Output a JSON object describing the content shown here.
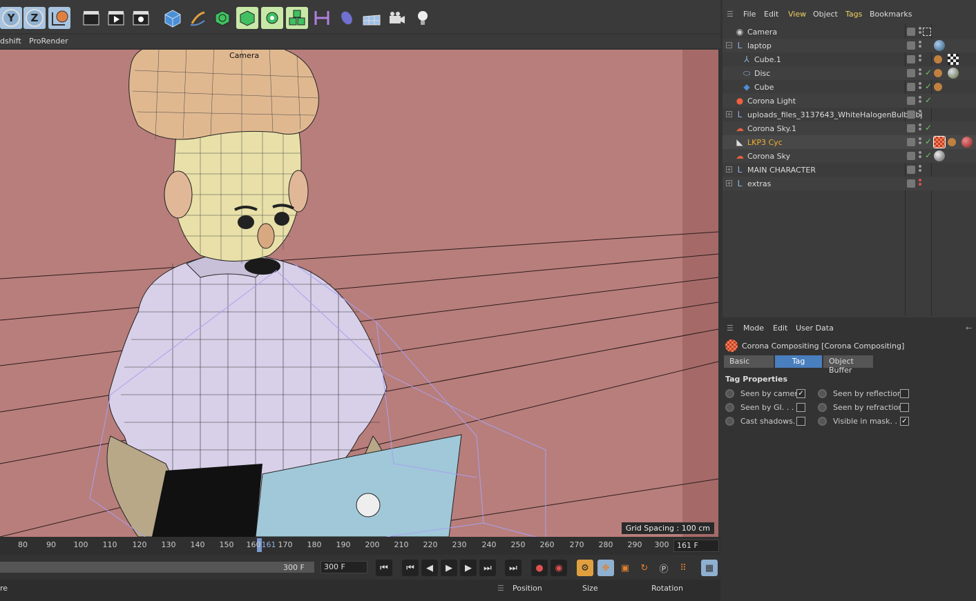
{
  "viewport_menu": {
    "items": [
      "dshift",
      "ProRender"
    ]
  },
  "viewport": {
    "camera_label": "Camera",
    "grid_spacing": "Grid Spacing : 100 cm"
  },
  "toolbar": {
    "axis_buttons": [
      "Y",
      "Z"
    ]
  },
  "timeline": {
    "ticks": [
      "80",
      "90",
      "100",
      "110",
      "120",
      "130",
      "140",
      "150",
      "160",
      "161",
      "170",
      "180",
      "190",
      "200",
      "210",
      "220",
      "230",
      "240",
      "250",
      "260",
      "270",
      "280",
      "290",
      "300"
    ],
    "current_frame": "161 F",
    "end_frame": "300 F",
    "max_frame": "300 F"
  },
  "bottom_bar": {
    "left": "re",
    "position": "Position",
    "size": "Size",
    "rotation": "Rotation"
  },
  "object_manager": {
    "menu": [
      "File",
      "Edit",
      "View",
      "Object",
      "Tags",
      "Bookmarks"
    ],
    "objects": [
      {
        "name": "Camera",
        "icon": "camera-icon"
      },
      {
        "name": "laptop",
        "icon": "null-icon"
      },
      {
        "name": "Cube.1",
        "icon": "bend-icon"
      },
      {
        "name": "Disc",
        "icon": "disc-icon"
      },
      {
        "name": "Cube",
        "icon": "cube-icon"
      },
      {
        "name": "Corona Light",
        "icon": "light-icon"
      },
      {
        "name": "uploads_files_3137643_WhiteHalogenBulb.obj",
        "icon": "null-icon"
      },
      {
        "name": "Corona Sky.1",
        "icon": "sky-icon"
      },
      {
        "name": "LKP3 Cyc",
        "icon": "cyc-icon"
      },
      {
        "name": "Corona Sky",
        "icon": "sky-icon"
      },
      {
        "name": "MAIN CHARACTER",
        "icon": "null-icon"
      },
      {
        "name": "extras",
        "icon": "null-icon"
      }
    ]
  },
  "attribute_manager": {
    "menu": [
      "Mode",
      "Edit",
      "User Data"
    ],
    "title": "Corona Compositing [Corona Compositing]",
    "tabs": [
      "Basic",
      "Tag",
      "Object Buffer"
    ],
    "active_tab": "Tag",
    "section": "Tag Properties",
    "properties": [
      {
        "label": "Seen by camera",
        "checked": true
      },
      {
        "label": "Seen by reflections",
        "checked": false
      },
      {
        "label": "Seen by GI. . . .",
        "checked": false
      },
      {
        "label": "Seen by refractions",
        "checked": false
      },
      {
        "label": "Cast shadows. .",
        "checked": false
      },
      {
        "label": "Visible in mask. . .",
        "checked": true
      }
    ]
  },
  "colors": {
    "viewport_bg": "#b87e7c",
    "selected_text": "#f0b030",
    "active_tab": "#4a7fbf",
    "check_green": "#6fc06f",
    "cage_lines": "#a8a0f0"
  }
}
